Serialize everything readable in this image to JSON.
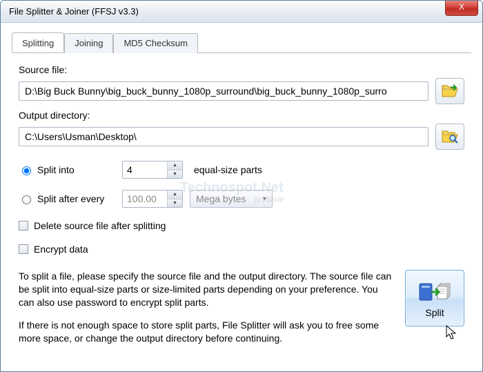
{
  "window": {
    "title": "File Splitter & Joiner (FFSJ v3.3)",
    "close": "X"
  },
  "tabs": {
    "splitting": "Splitting",
    "joining": "Joining",
    "md5": "MD5 Checksum"
  },
  "source": {
    "label": "Source file:",
    "value": "D:\\Big Buck Bunny\\big_buck_bunny_1080p_surround\\big_buck_bunny_1080p_surro"
  },
  "output": {
    "label": "Output directory:",
    "value": "C:\\Users\\Usman\\Desktop\\"
  },
  "split_into": {
    "label": "Split into",
    "value": "4",
    "suffix": "equal-size parts"
  },
  "split_after": {
    "label": "Split after every",
    "value": "100.00",
    "unit": "Mega bytes"
  },
  "delete_after": "Delete source file after splitting",
  "encrypt": "Encrypt data",
  "help": {
    "p1": "To split a file, please specify the source file and the output directory. The source file can be split into equal-size parts or size-limited parts depending on your preference. You can also use password to encrypt split parts.",
    "p2": "If there is not enough space to store split parts, File Splitter will ask you to free some more space, or change the output directory before continuing."
  },
  "split_button": "Split",
  "watermark": {
    "main": "Technospot.Net",
    "sub": "@TSNW"
  }
}
